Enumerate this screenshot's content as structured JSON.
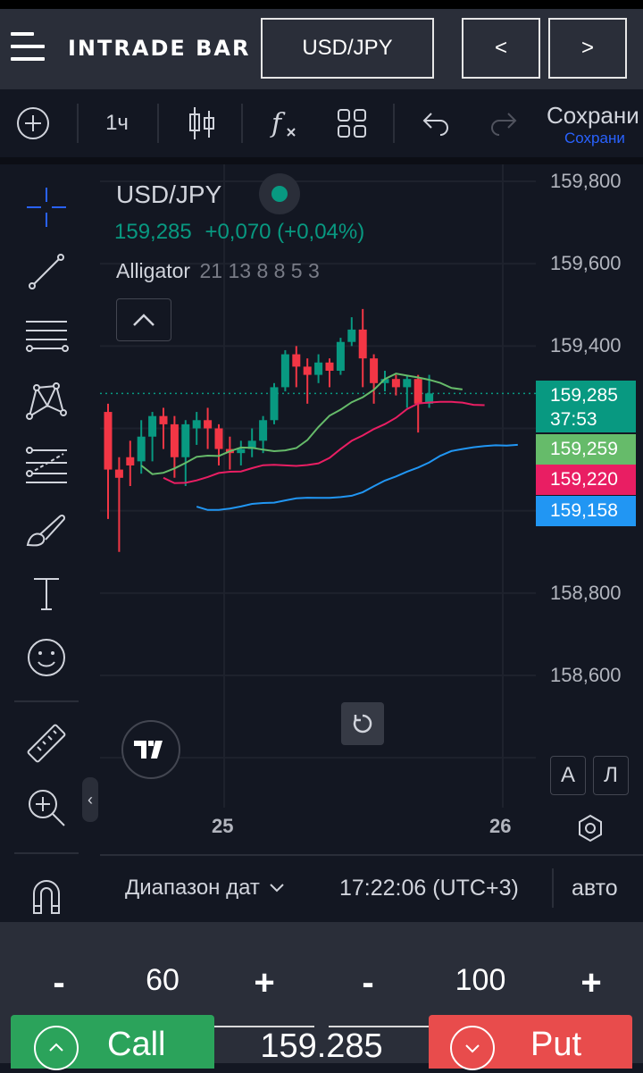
{
  "header": {
    "logo": "INTRADE BAR",
    "pair": "USD/JPY",
    "prev": "<",
    "next": ">"
  },
  "toolbar": {
    "interval": "1ч",
    "save_label": "Сохрани",
    "save_sub": "Сохрани"
  },
  "legend": {
    "symbol": "USD/JPY",
    "price": "159,285",
    "change": "+0,070 (+0,04%)",
    "indicator_name": "Alligator",
    "indicator_params": "21 13 8 8 5 3"
  },
  "chart_data": {
    "type": "candlestick",
    "ylim": [
      158500,
      159850
    ],
    "y_ticks": [
      "159,800",
      "159,600",
      "159,400",
      "158,800",
      "158,600"
    ],
    "x_ticks": [
      "25",
      "26"
    ],
    "price_labels": [
      {
        "value": "159,285",
        "sub": "37:53",
        "color": "#089981"
      },
      {
        "value": "159,259",
        "color": "#66bb6a"
      },
      {
        "value": "159,220",
        "color": "#e91e63"
      },
      {
        "value": "159,158",
        "color": "#2196f3"
      }
    ],
    "candles": [
      {
        "o": 159240,
        "c": 159100,
        "h": 159260,
        "l": 158980
      },
      {
        "o": 159100,
        "c": 159080,
        "h": 159130,
        "l": 158900
      },
      {
        "o": 159130,
        "c": 159110,
        "h": 159170,
        "l": 159060
      },
      {
        "o": 159120,
        "c": 159180,
        "h": 159220,
        "l": 159090
      },
      {
        "o": 159180,
        "c": 159230,
        "h": 159240,
        "l": 159120
      },
      {
        "o": 159230,
        "c": 159210,
        "h": 159250,
        "l": 159150
      },
      {
        "o": 159210,
        "c": 159130,
        "h": 159230,
        "l": 159080
      },
      {
        "o": 159130,
        "c": 159210,
        "h": 159220,
        "l": 159060
      },
      {
        "o": 159200,
        "c": 159220,
        "h": 159240,
        "l": 159160
      },
      {
        "o": 159220,
        "c": 159200,
        "h": 159250,
        "l": 159150
      },
      {
        "o": 159200,
        "c": 159150,
        "h": 159210,
        "l": 159110
      },
      {
        "o": 159150,
        "c": 159140,
        "h": 159180,
        "l": 159100
      },
      {
        "o": 159140,
        "c": 159150,
        "h": 159170,
        "l": 159110
      },
      {
        "o": 159150,
        "c": 159170,
        "h": 159200,
        "l": 159130
      },
      {
        "o": 159170,
        "c": 159220,
        "h": 159230,
        "l": 159140
      },
      {
        "o": 159220,
        "c": 159300,
        "h": 159310,
        "l": 159210
      },
      {
        "o": 159300,
        "c": 159380,
        "h": 159390,
        "l": 159290
      },
      {
        "o": 159380,
        "c": 159350,
        "h": 159400,
        "l": 159300
      },
      {
        "o": 159350,
        "c": 159330,
        "h": 159370,
        "l": 159260
      },
      {
        "o": 159330,
        "c": 159360,
        "h": 159380,
        "l": 159310
      },
      {
        "o": 159360,
        "c": 159340,
        "h": 159370,
        "l": 159300
      },
      {
        "o": 159340,
        "c": 159410,
        "h": 159420,
        "l": 159330
      },
      {
        "o": 159410,
        "c": 159440,
        "h": 159470,
        "l": 159400
      },
      {
        "o": 159440,
        "c": 159370,
        "h": 159490,
        "l": 159300
      },
      {
        "o": 159370,
        "c": 159310,
        "h": 159380,
        "l": 159260
      },
      {
        "o": 159310,
        "c": 159320,
        "h": 159340,
        "l": 159290
      },
      {
        "o": 159320,
        "c": 159300,
        "h": 159330,
        "l": 159280
      },
      {
        "o": 159300,
        "c": 159320,
        "h": 159330,
        "l": 159250
      },
      {
        "o": 159320,
        "c": 159260,
        "h": 159330,
        "l": 159190
      },
      {
        "o": 159260,
        "c": 159285,
        "h": 159330,
        "l": 159250
      }
    ],
    "alligator": {
      "lips_color": "#66bb6a",
      "teeth_color": "#e91e63",
      "jaw_color": "#2196f3"
    }
  },
  "bottom": {
    "range_label": "Диапазон дат",
    "time": "17:22:06 (UTC+3)",
    "auto": "авто",
    "btn_a": "А",
    "btn_l": "Л"
  },
  "trade": {
    "time_minus": "-",
    "time_value": "60",
    "time_plus": "+",
    "amount_minus": "-",
    "amount_value": "100",
    "amount_plus": "+",
    "call_label": "Call",
    "put_label": "Put",
    "current_price": "159.285"
  }
}
